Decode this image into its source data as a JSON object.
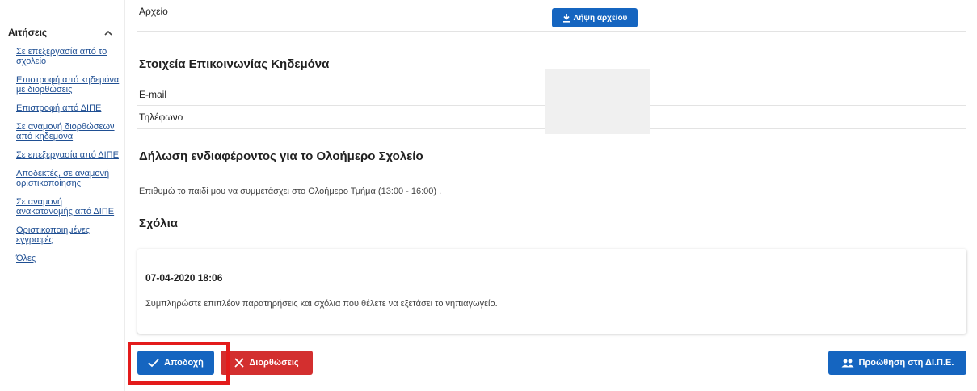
{
  "sidebar": {
    "title": "Αιτήσεις",
    "items": [
      {
        "line1": "Σε επεξεργασία από το",
        "line2": "σχολείο"
      },
      {
        "line1": "Επιστροφή από κηδεμόνα",
        "line2": "με διορθώσεις"
      },
      {
        "line1": "Επιστροφή από ΔΙΠΕ",
        "line2": ""
      },
      {
        "line1": "Σε αναμονή διορθώσεων",
        "line2": "από κηδεμόνα"
      },
      {
        "line1": "Σε επεξεργασία από ΔΙΠΕ",
        "line2": ""
      },
      {
        "line1": "Αποδεκτές, σε αναμονή",
        "line2": "οριστικοποίησης"
      },
      {
        "line1": "Σε αναμονή",
        "line2": "ανακατανομής από ΔΙΠΕ"
      },
      {
        "line1": "Οριστικοποιημένες",
        "line2": "εγγραφές"
      },
      {
        "line1": "Όλες",
        "line2": ""
      }
    ]
  },
  "file_row": {
    "label": "Αρχείο",
    "download_label": "Λήψη αρχείου"
  },
  "guardian_contact": {
    "title": "Στοιχεία Επικοινωνίας Κηδεμόνα",
    "email_label": "E-mail",
    "phone_label": "Τηλέφωνο"
  },
  "allday_school": {
    "title": "Δήλωση ενδιαφέροντος για το Ολοήμερο Σχολείο",
    "text": "Επιθυμώ το παιδί μου να συμμετάσχει στο Ολοήμερο Τμήμα (13:00 - 16:00) ."
  },
  "comments": {
    "title": "Σχόλια",
    "date": "07-04-2020 18:06",
    "text": "Συμπληρώστε επιπλέον παρατηρήσεις και σχόλια που θέλετε να εξετάσει το νηπιαγωγείο."
  },
  "actions": {
    "accept_label": "Αποδοχή",
    "corrections_label": "Διορθώσεις",
    "promote_label": "Προώθηση στη ΔΙ.Π.Ε."
  },
  "colors": {
    "primary": "#1565c0",
    "danger": "#d32f2f",
    "highlight": "#e31b1b",
    "link": "#1f4f93"
  },
  "icons": {
    "collapse": "chevron-up-icon",
    "download": "download-icon",
    "accept": "check-icon",
    "corrections": "close-icon",
    "promote": "users-icon"
  }
}
